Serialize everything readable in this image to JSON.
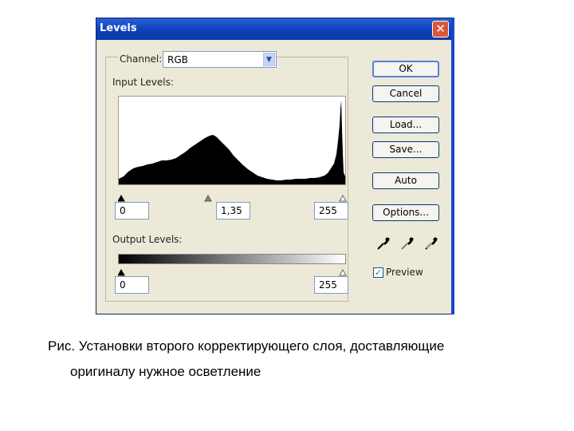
{
  "dialog": {
    "title": "Levels",
    "close_symbol": "✕"
  },
  "channel": {
    "label": "Channel:",
    "value": "RGB"
  },
  "input_levels": {
    "label": "Input Levels:",
    "black": "0",
    "gamma": "1,35",
    "white": "255"
  },
  "output_levels": {
    "label": "Output Levels:",
    "black": "0",
    "white": "255"
  },
  "buttons": {
    "ok": "OK",
    "cancel": "Cancel",
    "load": "Load...",
    "save": "Save...",
    "auto": "Auto",
    "options": "Options..."
  },
  "preview": {
    "label": "Preview",
    "checked": true
  },
  "eyedroppers": [
    "black-eyedropper-icon",
    "gray-eyedropper-icon",
    "white-eyedropper-icon"
  ],
  "caption": {
    "line1": "Рис. Установки второго корректирующего слоя, доставляющие",
    "line2": "оригиналу нужное осветление"
  },
  "colors": {
    "titlebar": "#0a3fb8",
    "dialog_bg": "#ece9d8",
    "close": "#d8573c"
  }
}
